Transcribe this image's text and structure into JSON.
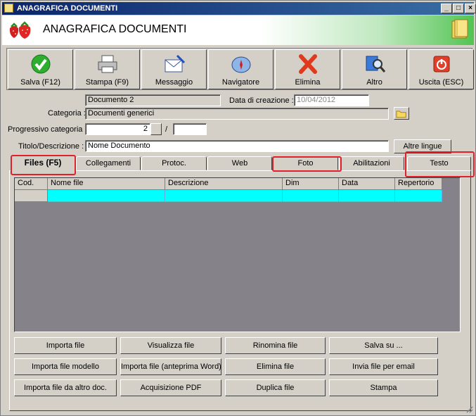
{
  "window": {
    "title": "ANAGRAFICA DOCUMENTI",
    "minimize_glyph": "_",
    "maximize_glyph": "□",
    "close_glyph": "×"
  },
  "banner": {
    "title": "ANAGRAFICA DOCUMENTI",
    "logo_icon": "strawberries-icon",
    "right_icon": "book-icon"
  },
  "toolbar": {
    "buttons": [
      {
        "label": "Salva (F12)",
        "icon": "check-icon"
      },
      {
        "label": "Stampa (F9)",
        "icon": "printer-icon"
      },
      {
        "label": "Messaggio",
        "icon": "envelope-icon"
      },
      {
        "label": "Navigatore",
        "icon": "compass-icon"
      },
      {
        "label": "Elimina",
        "icon": "delete-x-icon"
      },
      {
        "label": "Altro",
        "icon": "search-icon"
      },
      {
        "label": "Uscita (ESC)",
        "icon": "power-icon"
      }
    ]
  },
  "form": {
    "document_name": "Documento 2",
    "creation_date_label": "Data di creazione :",
    "creation_date_value": "10/04/2012",
    "category_label": "Categoria :",
    "category_value": "Documenti generici",
    "progressive_label": "Progressivo categoria :",
    "progressive_value": "2",
    "progressive_separator": "/",
    "progressive_suffix": "",
    "title_label": "Titolo/Descrizione :",
    "title_value": "Nome Documento",
    "other_languages_button": "Altre lingue"
  },
  "tabs": [
    {
      "label": "Files (F5)",
      "active": true,
      "highlighted": true
    },
    {
      "label": "Collegamenti",
      "active": false,
      "highlighted": false
    },
    {
      "label": "Protoc.",
      "active": false,
      "highlighted": false
    },
    {
      "label": "Web",
      "active": false,
      "highlighted": false
    },
    {
      "label": "Foto",
      "active": false,
      "highlighted": true
    },
    {
      "label": "Abilitazioni",
      "active": false,
      "highlighted": false
    },
    {
      "label": "Testo",
      "active": false,
      "highlighted": true
    }
  ],
  "grid": {
    "columns": [
      "Cod.",
      "Nome file",
      "Descrizione",
      "Dim",
      "Data",
      "Repertorio"
    ],
    "rows": [
      [
        "",
        "",
        "",
        "",
        "",
        ""
      ]
    ]
  },
  "actions": {
    "importa_file": "Importa file",
    "visualizza_file": "Visualizza file",
    "rinomina_file": "Rinomina file",
    "salva_su": "Salva su ...",
    "importa_file_modello": "Importa file modello",
    "importa_file_anteprima": "Importa file (anteprima Word)",
    "elimina_file": "Elimina file",
    "invia_file_email": "Invia file per email",
    "importa_file_altro_doc": "Importa file da altro doc.",
    "acquisizione_pdf": "Acquisizione PDF",
    "duplica_file": "Duplica file",
    "stampa": "Stampa"
  },
  "colors": {
    "title_bar": "#0a246a",
    "banner_green": "#52c452",
    "selected_row": "#00ffff",
    "grid_background": "#858389",
    "highlight_outline": "#e0202a"
  }
}
